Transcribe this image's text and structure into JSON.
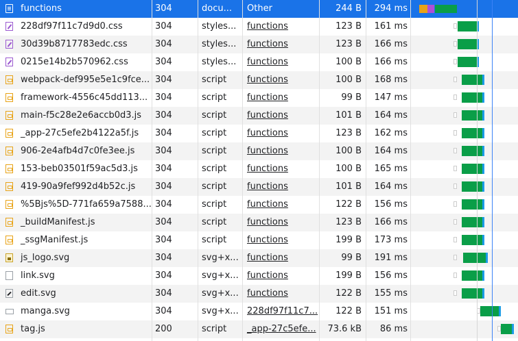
{
  "requests": [
    {
      "name": "functions",
      "status": "304",
      "type": "docu...",
      "initiator": "Other",
      "size": "244 B",
      "time": "294 ms",
      "icon": "document-icon",
      "selected": true
    },
    {
      "name": "228df97f11c7d9d0.css",
      "status": "304",
      "type": "styles...",
      "initiator": "functions",
      "size": "123 B",
      "time": "161 ms",
      "icon": "stylesheet-icon"
    },
    {
      "name": "30d39b8717783edc.css",
      "status": "304",
      "type": "styles...",
      "initiator": "functions",
      "size": "123 B",
      "time": "166 ms",
      "icon": "stylesheet-icon"
    },
    {
      "name": "0215e14b2b570962.css",
      "status": "304",
      "type": "styles...",
      "initiator": "functions",
      "size": "100 B",
      "time": "166 ms",
      "icon": "stylesheet-icon"
    },
    {
      "name": "webpack-def995e5e1c9fce...",
      "status": "304",
      "type": "script",
      "initiator": "functions",
      "size": "100 B",
      "time": "168 ms",
      "icon": "script-icon"
    },
    {
      "name": "framework-4556c45dd113...",
      "status": "304",
      "type": "script",
      "initiator": "functions",
      "size": "99 B",
      "time": "147 ms",
      "icon": "script-icon"
    },
    {
      "name": "main-f5c28e2e6accb0d3.js",
      "status": "304",
      "type": "script",
      "initiator": "functions",
      "size": "101 B",
      "time": "164 ms",
      "icon": "script-icon"
    },
    {
      "name": "_app-27c5efe2b4122a5f.js",
      "status": "304",
      "type": "script",
      "initiator": "functions",
      "size": "123 B",
      "time": "162 ms",
      "icon": "script-icon"
    },
    {
      "name": "906-2e4afb4d7c0fe3ee.js",
      "status": "304",
      "type": "script",
      "initiator": "functions",
      "size": "100 B",
      "time": "164 ms",
      "icon": "script-icon"
    },
    {
      "name": "153-beb03501f59ac5d3.js",
      "status": "304",
      "type": "script",
      "initiator": "functions",
      "size": "100 B",
      "time": "165 ms",
      "icon": "script-icon"
    },
    {
      "name": "419-90a9fef992d4b52c.js",
      "status": "304",
      "type": "script",
      "initiator": "functions",
      "size": "101 B",
      "time": "164 ms",
      "icon": "script-icon"
    },
    {
      "name": "%5Bjs%5D-771fa659a7588...",
      "status": "304",
      "type": "script",
      "initiator": "functions",
      "size": "122 B",
      "time": "156 ms",
      "icon": "script-icon"
    },
    {
      "name": "_buildManifest.js",
      "status": "304",
      "type": "script",
      "initiator": "functions",
      "size": "123 B",
      "time": "166 ms",
      "icon": "script-icon"
    },
    {
      "name": "_ssgManifest.js",
      "status": "304",
      "type": "script",
      "initiator": "functions",
      "size": "199 B",
      "time": "173 ms",
      "icon": "script-icon"
    },
    {
      "name": "js_logo.svg",
      "status": "304",
      "type": "svg+x...",
      "initiator": "functions",
      "size": "99 B",
      "time": "191 ms",
      "icon": "svg-image-icon"
    },
    {
      "name": "link.svg",
      "status": "304",
      "type": "svg+x...",
      "initiator": "functions",
      "size": "199 B",
      "time": "156 ms",
      "icon": "blank-file-icon"
    },
    {
      "name": "edit.svg",
      "status": "304",
      "type": "svg+x...",
      "initiator": "functions",
      "size": "122 B",
      "time": "155 ms",
      "icon": "edit-icon"
    },
    {
      "name": "manga.svg",
      "status": "304",
      "type": "svg+x...",
      "initiator": "228df97f11c7...",
      "size": "122 B",
      "time": "151 ms",
      "icon": "manga-image-icon"
    },
    {
      "name": "tag.js",
      "status": "200",
      "type": "script",
      "initiator": "_app-27c5efe...",
      "size": "73.6 kB",
      "time": "86 ms",
      "icon": "script-icon"
    }
  ],
  "colors": {
    "selected_row": "#1a73e8",
    "waterfall_receiving": "#0a9e48",
    "waterfall_download_tail": "#1a9be6",
    "load_event_line": "#3b82f6"
  }
}
